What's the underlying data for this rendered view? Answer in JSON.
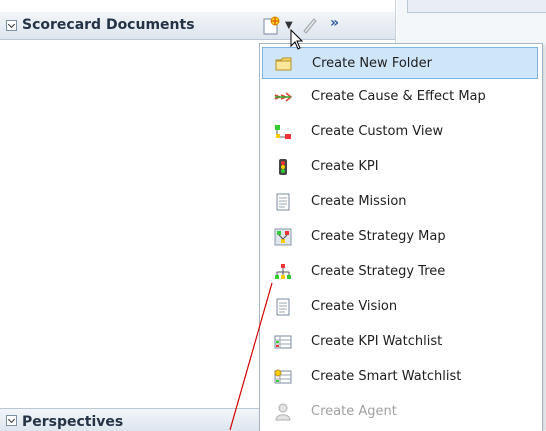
{
  "left_panel": {
    "title": "Scorecard Documents",
    "bottom_title": "Perspectives"
  },
  "toolbar": {
    "new_icon": "new-document-icon",
    "dropdown_icon": "dropdown-arrow-icon",
    "edit_icon": "pencil-icon",
    "more_label": "»"
  },
  "menu": {
    "items": [
      {
        "label": "Create New Folder",
        "icon": "folder-icon"
      },
      {
        "label": "Create Cause & Effect Map",
        "icon": "cause-effect-map-icon"
      },
      {
        "label": "Create Custom View",
        "icon": "custom-view-icon"
      },
      {
        "label": "Create KPI",
        "icon": "kpi-traffic-light-icon"
      },
      {
        "label": "Create Mission",
        "icon": "mission-document-icon"
      },
      {
        "label": "Create Strategy Map",
        "icon": "strategy-map-icon"
      },
      {
        "label": "Create Strategy Tree",
        "icon": "strategy-tree-icon"
      },
      {
        "label": "Create Vision",
        "icon": "vision-document-icon"
      },
      {
        "label": "Create KPI Watchlist",
        "icon": "kpi-watchlist-icon"
      },
      {
        "label": "Create Smart Watchlist",
        "icon": "smart-watchlist-icon"
      },
      {
        "label": "Create Agent",
        "icon": "agent-icon"
      }
    ]
  },
  "colors": {
    "selected_bg": "#cfe5f8",
    "annotation_line": "#d40000"
  }
}
